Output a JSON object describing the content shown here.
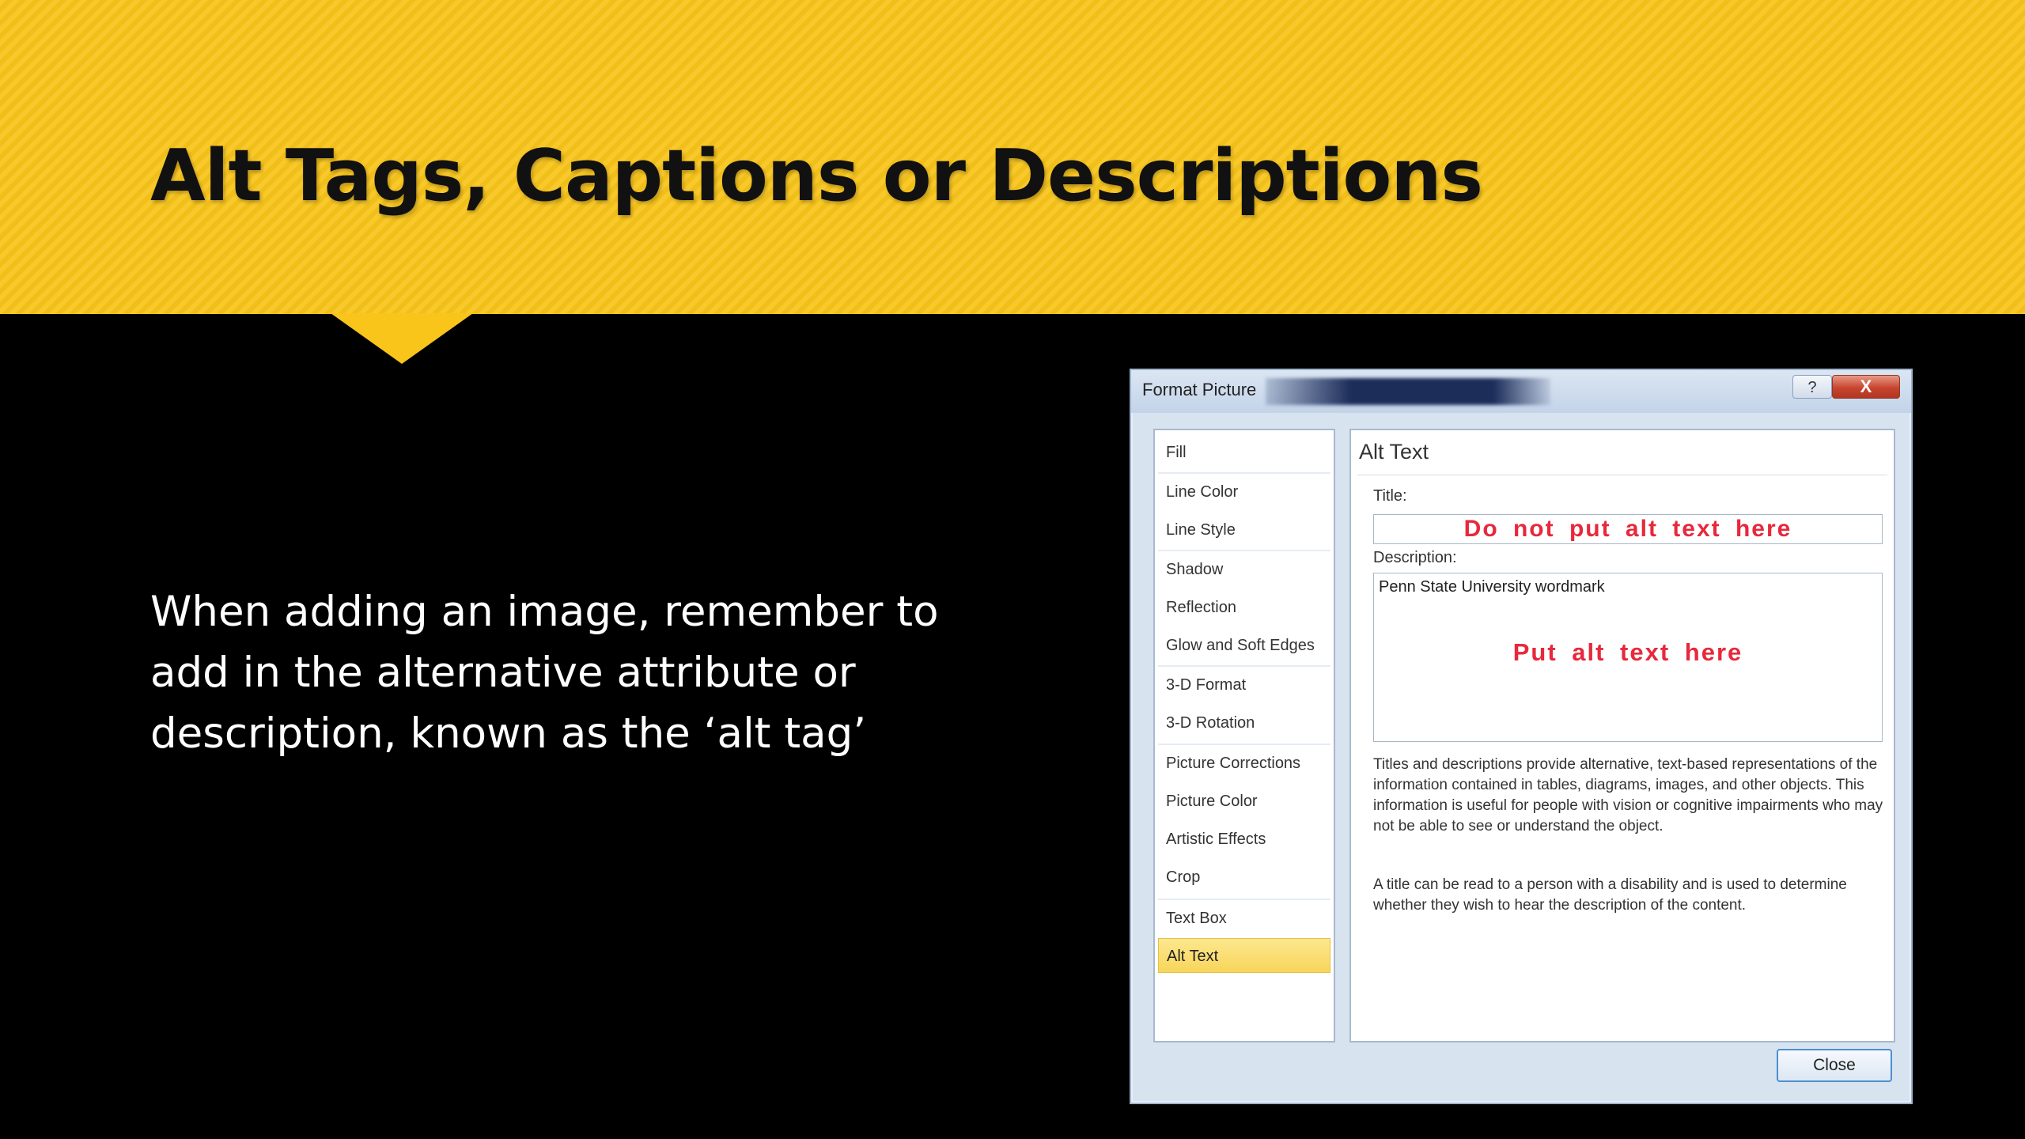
{
  "slide": {
    "title": "Alt Tags, Captions or Descriptions",
    "body_lines": [
      "When adding an image, remember to",
      "add in the alternative attribute or",
      "description, known as the ‘alt tag’"
    ]
  },
  "dialog": {
    "title": "Format Picture",
    "help_label": "?",
    "close_x_label": "X",
    "nav_items": [
      {
        "label": "Fill",
        "selected": false
      },
      {
        "label": "Line Color",
        "selected": false
      },
      {
        "label": "Line Style",
        "selected": false
      },
      {
        "label": "Shadow",
        "selected": false
      },
      {
        "label": "Reflection",
        "selected": false
      },
      {
        "label": "Glow and Soft Edges",
        "selected": false
      },
      {
        "label": "3-D Format",
        "selected": false
      },
      {
        "label": "3-D Rotation",
        "selected": false
      },
      {
        "label": "Picture Corrections",
        "selected": false
      },
      {
        "label": "Picture Color",
        "selected": false
      },
      {
        "label": "Artistic Effects",
        "selected": false
      },
      {
        "label": "Crop",
        "selected": false
      },
      {
        "label": "Text Box",
        "selected": false
      },
      {
        "label": "Alt Text",
        "selected": true
      }
    ],
    "panel": {
      "heading": "Alt Text",
      "title_label": "Title:",
      "title_overlay": "Do not put alt text here",
      "description_label": "Description:",
      "description_value": "Penn State University wordmark",
      "description_overlay": "Put alt text here",
      "help_paragraph_1": "Titles and descriptions provide alternative, text-based representations of the information contained in tables, diagrams, images, and other objects. This information is useful for people with vision or cognitive impairments who may not be able to see or understand the object.",
      "help_paragraph_2": "A title can be read to a person with a disability and is used to determine whether they wish to hear the description of the content."
    },
    "close_button": "Close"
  },
  "colors": {
    "banner": "#f9c51b",
    "background": "#000000",
    "annotation_red": "#e8283c",
    "selected_nav": "#f8d55a"
  }
}
